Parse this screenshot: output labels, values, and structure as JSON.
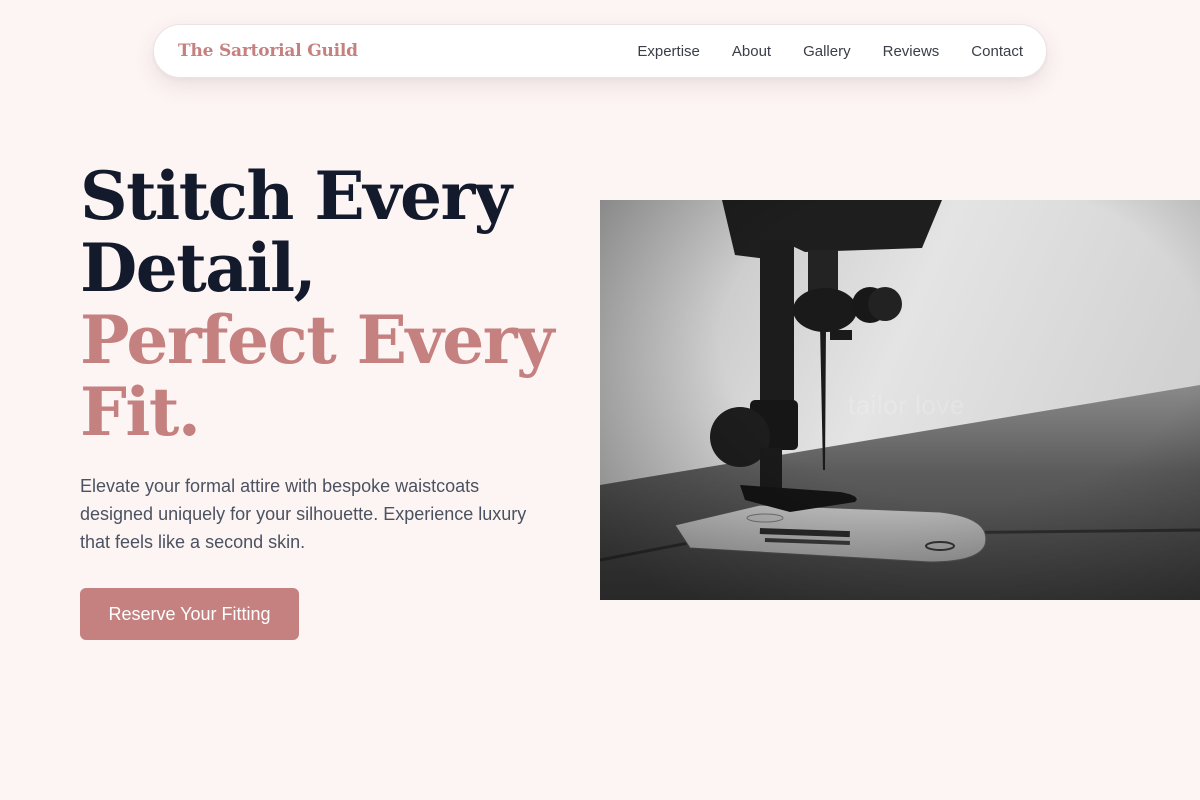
{
  "nav": {
    "brand": "The Sartorial Guild",
    "links": [
      "Expertise",
      "About",
      "Gallery",
      "Reviews",
      "Contact"
    ]
  },
  "hero": {
    "title_line1": "Stitch Every",
    "title_line2": "Detail,",
    "title_line3": "Perfect Every",
    "title_line4": "Fit.",
    "description": "Elevate your formal attire with bespoke waistcoats designed uniquely for your silhouette. Experience luxury that feels like a second skin.",
    "cta_label": "Reserve Your Fitting"
  },
  "image": {
    "caption": "tailor love",
    "subject": "sewing-machine-photo"
  },
  "colors": {
    "background": "#fdf4f4",
    "accent": "#c4817f",
    "heading": "#121a2c",
    "body_text": "#4b5260"
  }
}
